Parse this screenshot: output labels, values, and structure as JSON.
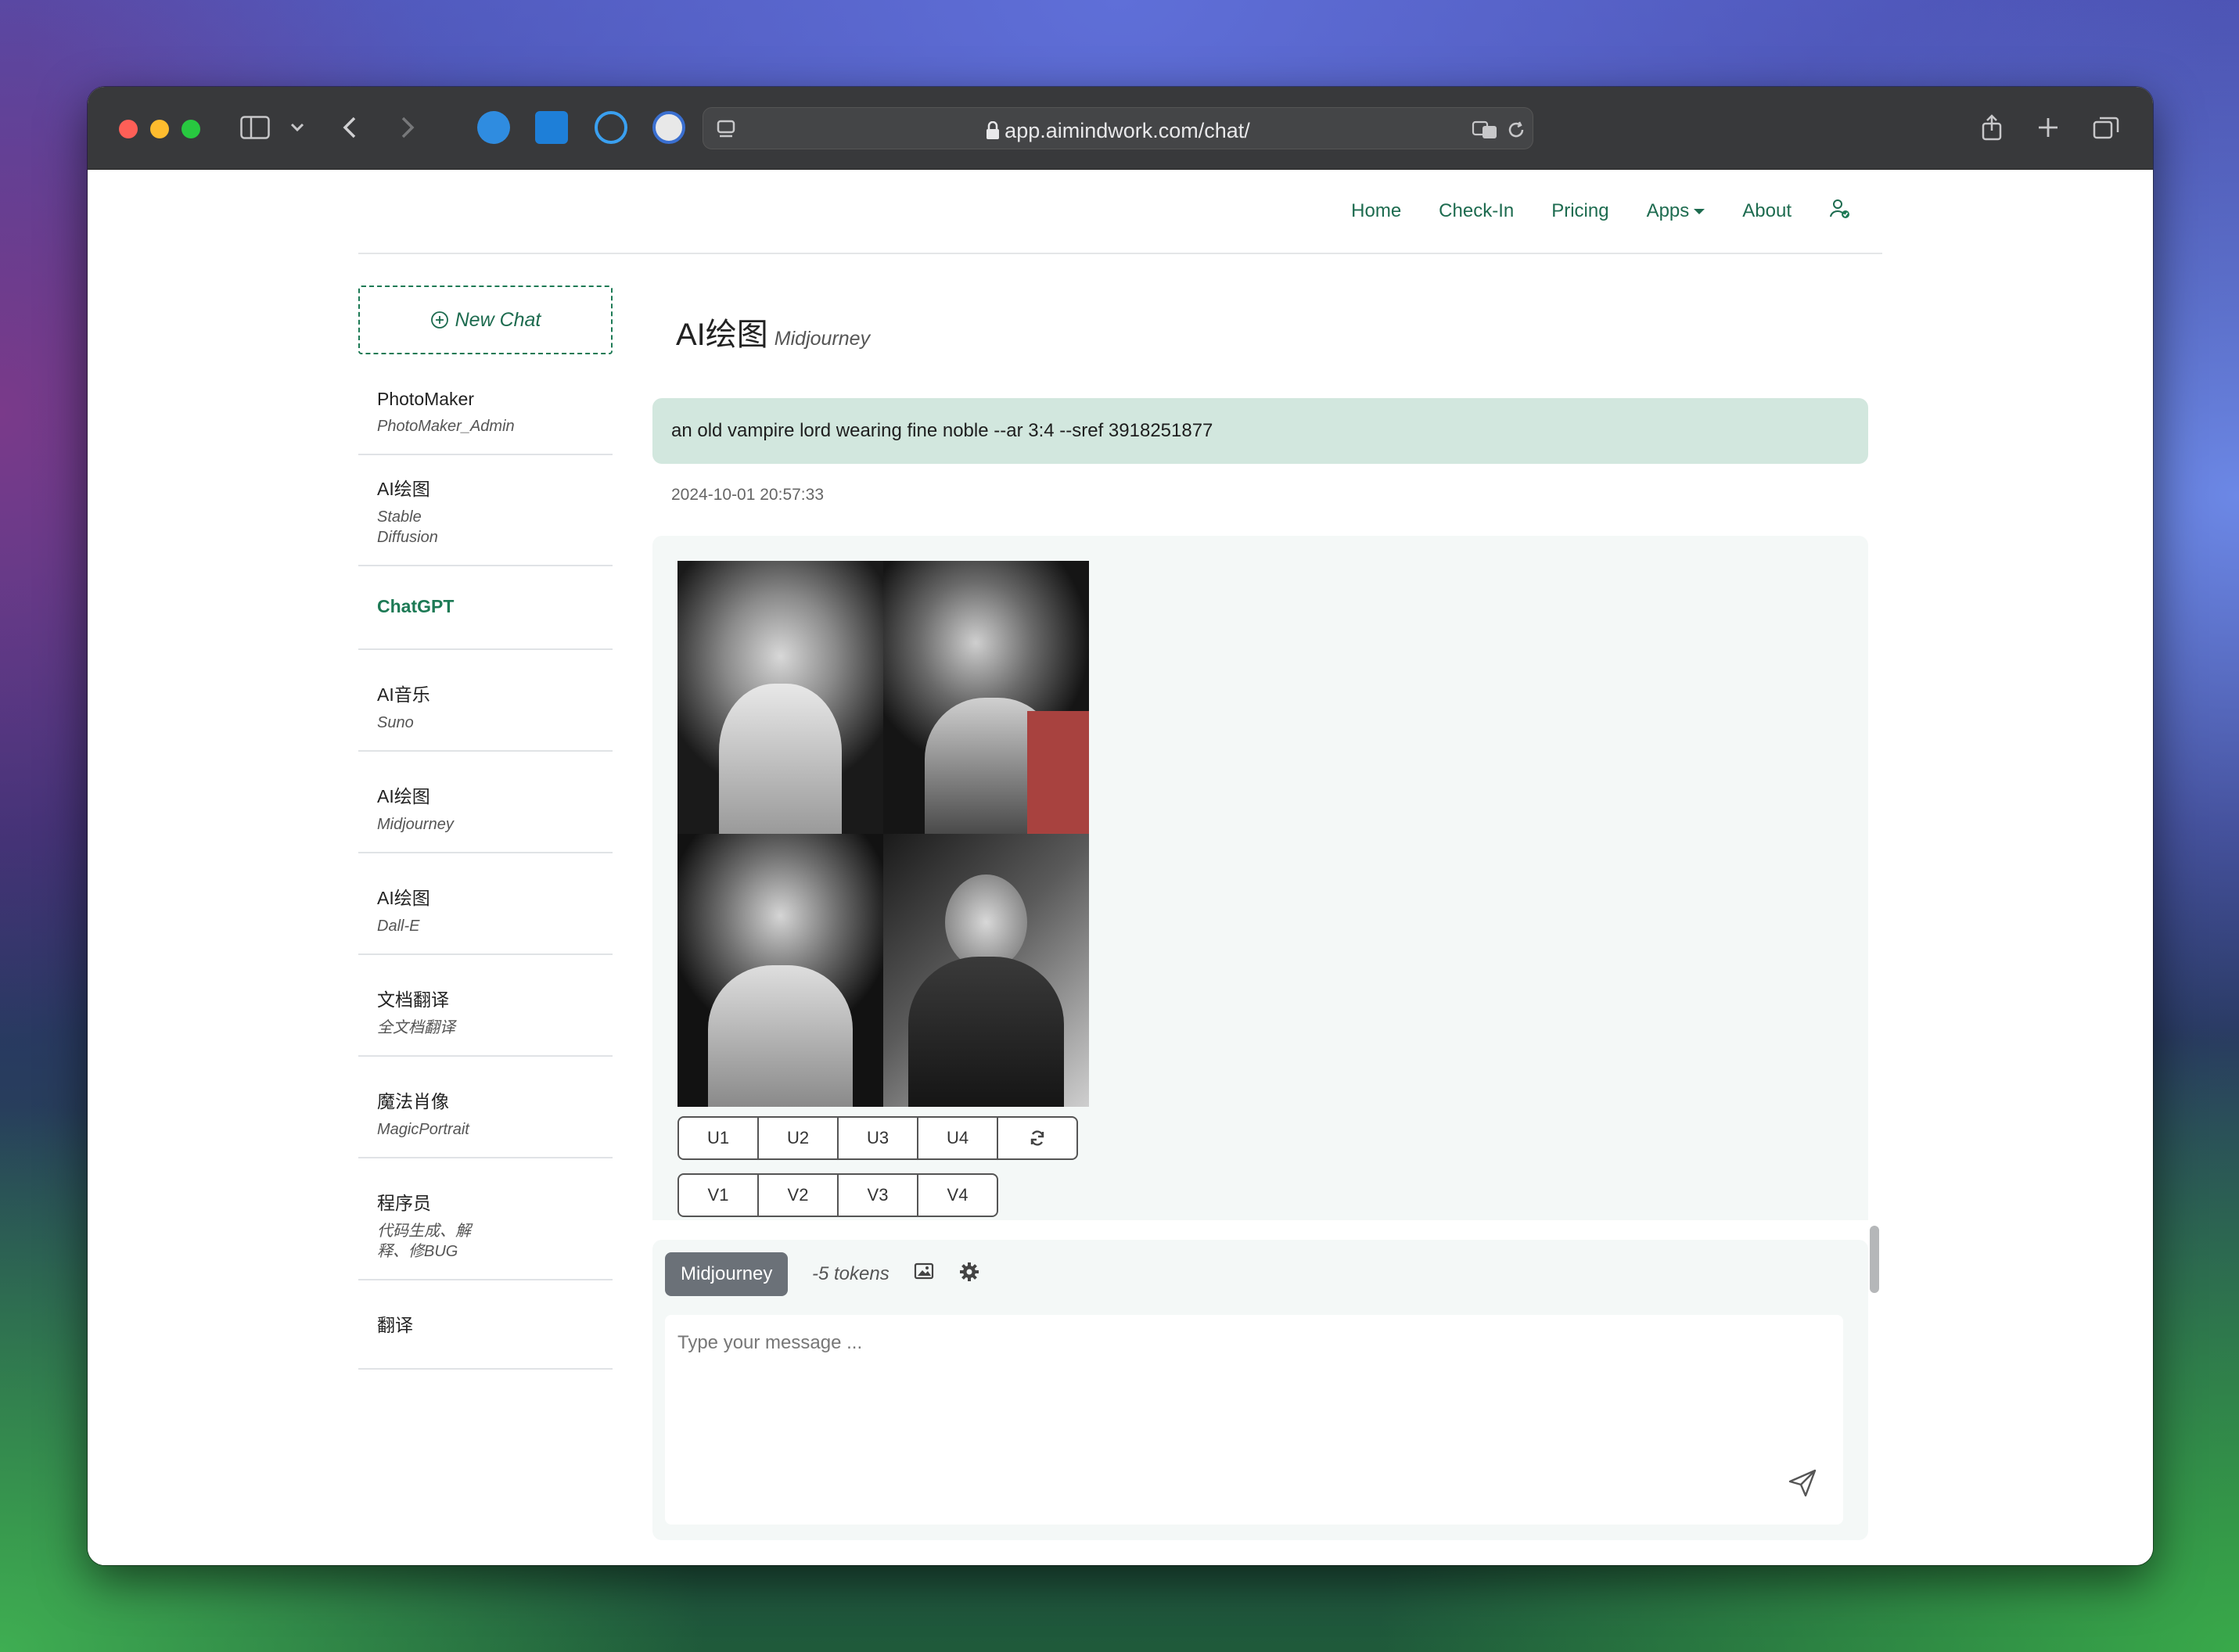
{
  "browser": {
    "url": "app.aimindwork.com/chat/"
  },
  "nav": {
    "links": [
      "Home",
      "Check-In",
      "Pricing",
      "Apps",
      "About"
    ]
  },
  "sidebar": {
    "new_chat": "New Chat",
    "items": [
      {
        "title": "PhotoMaker",
        "subtitle": "PhotoMaker_Admin"
      },
      {
        "title": "AI绘图",
        "subtitle": "Stable Diffusion"
      },
      {
        "title": "ChatGPT",
        "subtitle": ""
      },
      {
        "title": "AI音乐",
        "subtitle": "Suno"
      },
      {
        "title": "AI绘图",
        "subtitle": "Midjourney"
      },
      {
        "title": "AI绘图",
        "subtitle": "Dall-E"
      },
      {
        "title": "文档翻译",
        "subtitle": "全文档翻译"
      },
      {
        "title": "魔法肖像",
        "subtitle": "MagicPortrait"
      },
      {
        "title": "程序员",
        "subtitle": "代码生成、解释、修BUG"
      },
      {
        "title": "翻译",
        "subtitle": ""
      }
    ],
    "active_index": 2
  },
  "chat": {
    "title": "AI绘图",
    "subtitle": "Midjourney",
    "user_message": "an old vampire lord wearing fine noble --ar 3:4 --sref 3918251877",
    "timestamp": "2024-10-01 20:57:33",
    "upscale_buttons": [
      "U1",
      "U2",
      "U3",
      "U4"
    ],
    "variation_buttons": [
      "V1",
      "V2",
      "V3",
      "V4"
    ],
    "reroll_icon": "refresh-icon"
  },
  "composer": {
    "model": "Midjourney",
    "tokens": "-5 tokens",
    "placeholder": "Type your message ...",
    "image_icon": "image-icon",
    "settings_icon": "gear-icon",
    "send_icon": "send-icon"
  }
}
